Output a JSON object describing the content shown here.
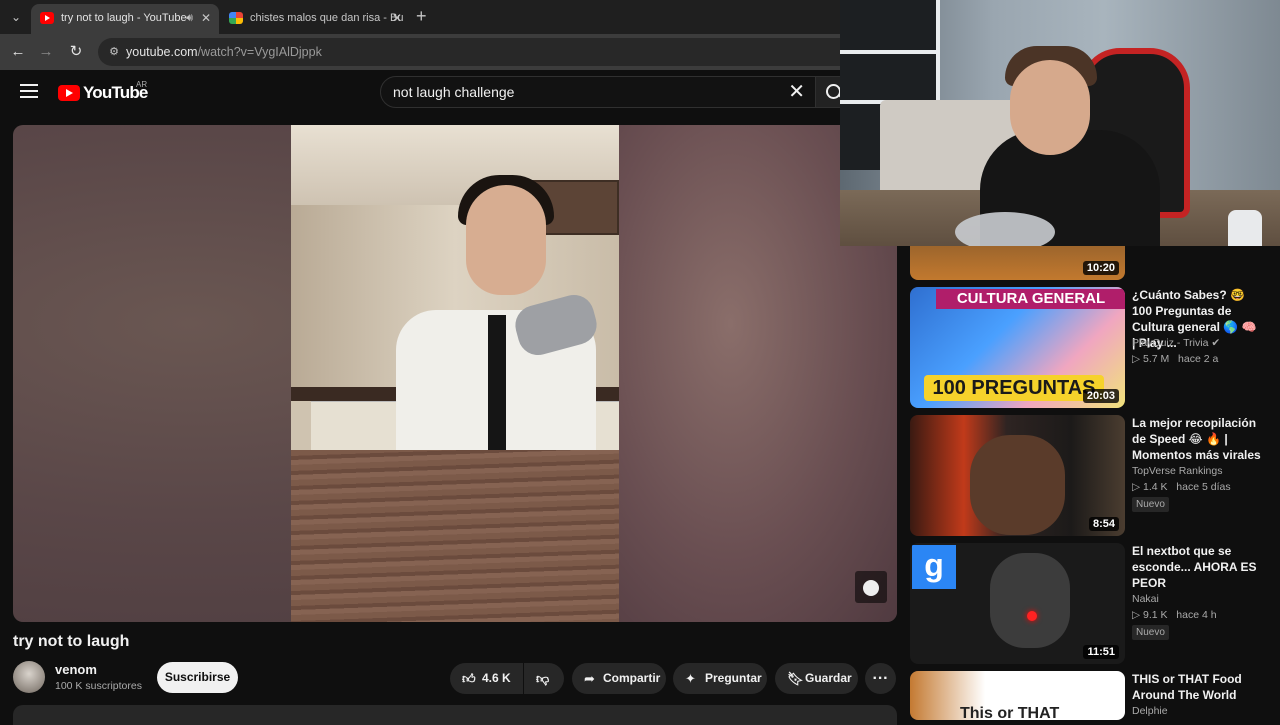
{
  "browser": {
    "tabs": [
      {
        "title": "try not to laugh - YouTube",
        "active": true,
        "audio": true
      },
      {
        "title": "chistes malos que dan risa - Bu",
        "active": false
      }
    ],
    "url_host": "youtube.com",
    "url_path": "/watch?v=VygIAlDjppk"
  },
  "youtube": {
    "logo_text": "YouTube",
    "country": "AR",
    "search_value": "not laugh challenge"
  },
  "video": {
    "title": "try not to laugh",
    "channel": "venom",
    "subscribers": "100 K suscriptores",
    "subscribe_label": "Suscribirse",
    "likes": "4.6 K",
    "share_label": "Compartir",
    "ask_label": "Preguntar",
    "save_label": "Guardar",
    "more_label": "···"
  },
  "recommendations": [
    {
      "duration": "10:20"
    },
    {
      "title": "¿Cuánto Sabes? 🤓 100 Preguntas de Cultura general 🌎 🧠 | Play ...",
      "channel": "PlayQuiz - Trivia ✔",
      "views": "5.7 M",
      "age": "hace 2 a",
      "duration": "20:03",
      "thumb_top": "CULTURA GENERAL",
      "thumb_bottom": "100 PREGUNTAS"
    },
    {
      "title": "La mejor recopilación de Speed 😂 🔥 | Momentos más virales",
      "channel": "TopVerse Rankings",
      "views": "1.4 K",
      "age": "hace 5 días",
      "badge": "Nuevo",
      "duration": "8:54"
    },
    {
      "title": "El nextbot que se esconde... AHORA ES PEOR",
      "channel": "Nakai",
      "views": "9.1 K",
      "age": "hace 4 h",
      "badge": "Nuevo",
      "duration": "11:51",
      "thumb_letter": "g"
    },
    {
      "title": "THIS or THAT Food Around The World",
      "channel": "Delphie",
      "thumb_text": "This or THAT"
    }
  ],
  "colors": {
    "yt_red": "#ff0000",
    "bg": "#0f0f0f",
    "pill": "#272727"
  }
}
